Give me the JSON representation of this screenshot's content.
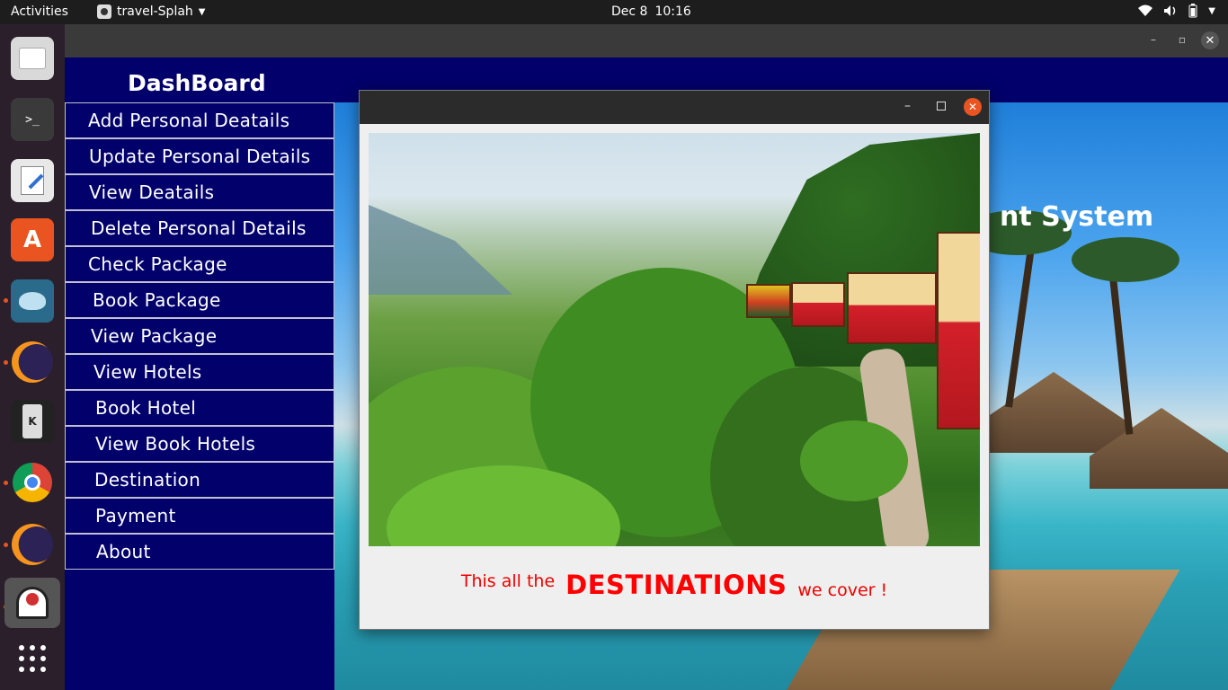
{
  "topbar": {
    "activities": "Activities",
    "app_name": "travel-Splah",
    "date": "Dec 8",
    "time": "10:16"
  },
  "dock": {
    "items": [
      "files-icon",
      "terminal-icon",
      "text-editor-icon",
      "software-center-icon",
      "mysql-workbench-icon",
      "eclipse-icon",
      "kde-connect-icon",
      "chrome-icon",
      "eclipse-icon",
      "java-icon",
      "app-grid-icon"
    ]
  },
  "dashboard": {
    "title": "DashBoard",
    "menu": [
      "Add Personal Deatails",
      "Update Personal Details",
      "View Deatails",
      "Delete Personal Details",
      "Check Package",
      "Book Package",
      "View Package",
      "View Hotels",
      "Book Hotel",
      "View Book Hotels",
      "Destination",
      "Payment",
      "About"
    ],
    "background_title": "nt System"
  },
  "dialog": {
    "caption_prefix": "This all the",
    "caption_highlight": "DESTINATIONS",
    "caption_suffix": "we cover !"
  },
  "colors": {
    "dashboard_bg": "#02006b",
    "caption_red": "#ff0000",
    "close_orange": "#e95420"
  }
}
